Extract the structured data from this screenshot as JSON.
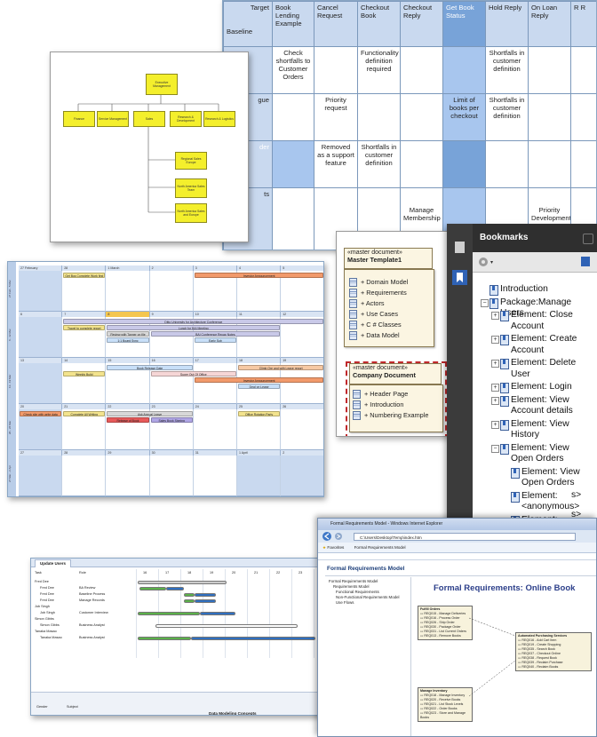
{
  "matrix": {
    "corner_top": "Target",
    "corner_bottom": "Baseline",
    "columns": [
      "Book Lending Example",
      "Cancel Request",
      "Checkout Book",
      "Checkout Reply",
      "Get Book Status",
      "Hold Reply",
      "On Loan Reply",
      "R R"
    ],
    "rows": [
      {
        "label": "",
        "cells": [
          "Check shortfalls to Customer Orders",
          "",
          "Functionality definition required",
          "",
          "",
          "Shortfalls in customer definition",
          "",
          ""
        ]
      },
      {
        "label": "gue",
        "cells": [
          "",
          "Priority request",
          "",
          "",
          "Limit of books per checkout",
          "Shortfalls in customer definition",
          "",
          ""
        ]
      },
      {
        "label": "der",
        "cells": [
          "",
          "Removed as a support feature",
          "Shortfalls in customer definition",
          "",
          "",
          "",
          "",
          ""
        ]
      },
      {
        "label": "ts",
        "cells": [
          "",
          "",
          "",
          "Manage Membership",
          "",
          "",
          "Priority Development",
          ""
        ]
      }
    ]
  },
  "org_chart": {
    "root": "Executive Management",
    "level2": [
      "Finance",
      "Service Management",
      "Sales",
      "Research & Development",
      "Research & Logistics"
    ],
    "level3": [
      "Regional Sales Europe",
      "North America Sales Team",
      "North America Sales and Europe"
    ]
  },
  "calendar": {
    "day_headers": [
      [
        "27 February",
        "28",
        "1 March",
        "2",
        "3",
        "4",
        "5"
      ],
      [
        "6",
        "7",
        "8",
        "9",
        "10",
        "11",
        "12"
      ],
      [
        "13",
        "14",
        "15",
        "16",
        "17",
        "18",
        "19"
      ],
      [
        "20",
        "21",
        "22",
        "23",
        "24",
        "25",
        "26"
      ],
      [
        "27",
        "28",
        "29",
        "30",
        "31",
        "1 April",
        "2"
      ]
    ],
    "week_labels": [
      "27 Feb - 5 Mar",
      "6 - 12 Mar",
      "13 - 19 Mar",
      "20 - 26 Mar",
      "27 Mar - 2 Apr"
    ],
    "events": [
      {
        "text": "Get Bus Complete Work first",
        "week": 0,
        "start": 1,
        "span": 1,
        "row": 0,
        "color": "#f3e38d"
      },
      {
        "text": "Investor Announcement",
        "week": 0,
        "start": 4,
        "span": 3,
        "row": 0,
        "color": "#f29a6b"
      },
      {
        "text": "Ditto University for Architecture Conference",
        "week": 1,
        "start": 1,
        "span": 6,
        "row": 0,
        "color": "#c9c9e8"
      },
      {
        "text": "Travel to complete report",
        "week": 1,
        "start": 1,
        "span": 1,
        "row": 1,
        "color": "#f3e38d"
      },
      {
        "text": "Lunch for BAI Meeting",
        "week": 1,
        "start": 2,
        "span": 4,
        "row": 1,
        "color": "#c9c9e8"
      },
      {
        "text": "Review with Tanner on file",
        "week": 1,
        "start": 2,
        "span": 1,
        "row": 2,
        "color": "#d8d8d8"
      },
      {
        "text": "BAI Conference Recap Notes",
        "week": 1,
        "start": 3,
        "span": 3,
        "row": 2,
        "color": "#c9c9e8"
      },
      {
        "text": "1:1 Board Sync",
        "week": 1,
        "start": 2,
        "span": 1,
        "row": 3,
        "color": "#c8dff8"
      },
      {
        "text": "Early Sub",
        "week": 1,
        "start": 4,
        "span": 1,
        "row": 3,
        "color": "#c8dff8"
      },
      {
        "text": "Book Release Date",
        "week": 2,
        "start": 2,
        "span": 2,
        "row": 0,
        "color": "#c8dff8"
      },
      {
        "text": "Climb Ore and with Leave report",
        "week": 2,
        "start": 5,
        "span": 2,
        "row": 0,
        "color": "#f6c9a4"
      },
      {
        "text": "Weekly Build",
        "week": 2,
        "start": 1,
        "span": 1,
        "row": 1,
        "color": "#f3e38d"
      },
      {
        "text": "Super Out Of Office",
        "week": 2,
        "start": 3,
        "span": 2,
        "row": 1,
        "color": "#f6d6d6"
      },
      {
        "text": "Investor Announcement",
        "week": 2,
        "start": 4,
        "span": 3,
        "row": 2,
        "color": "#f29a6b"
      },
      {
        "text": "Deal on Lease",
        "week": 2,
        "start": 5,
        "span": 1,
        "row": 3,
        "color": "#c8dff8"
      },
      {
        "text": "Check site with write data",
        "week": 3,
        "start": 0,
        "span": 1,
        "row": 0,
        "color": "#f29a6b"
      },
      {
        "text": "Complete All Writing",
        "week": 3,
        "start": 1,
        "span": 1,
        "row": 0,
        "color": "#f3e38d"
      },
      {
        "text": "Ask Annual Leave",
        "week": 3,
        "start": 2,
        "span": 2,
        "row": 0,
        "color": "#d8d8d8"
      },
      {
        "text": "Office Rotation Party",
        "week": 3,
        "start": 5,
        "span": 1,
        "row": 0,
        "color": "#f3e38d"
      },
      {
        "text": "Release of Book",
        "week": 3,
        "start": 2,
        "span": 1,
        "row": 1,
        "color": "#e85a5a"
      },
      {
        "text": "Sales Book Signing",
        "week": 3,
        "start": 3,
        "span": 1,
        "row": 1,
        "color": "#b0a6e6"
      }
    ]
  },
  "master_docs": {
    "doc1": {
      "stereotype": "«master document»",
      "name": "Master Template1",
      "items": [
        "+ Domain Model",
        "+ Requirements",
        "+ Actors",
        "+ Use Cases",
        "+ C # Classes",
        "+ Data Model"
      ]
    },
    "doc2": {
      "stereotype": "«master document»",
      "name": "Company Document",
      "items": [
        "+ Header Page",
        "+ Introduction",
        "+ Numbering Example"
      ]
    }
  },
  "bookmarks": {
    "title": "Bookmarks",
    "nodes": [
      {
        "label": "Introduction",
        "level": 0,
        "pm": ""
      },
      {
        "label": "Package:Manage Users",
        "level": 0,
        "pm": "−"
      },
      {
        "label": "Element: Close Account",
        "level": 1,
        "pm": "+"
      },
      {
        "label": "Element: Create Account",
        "level": 1,
        "pm": "+"
      },
      {
        "label": "Element: Delete User",
        "level": 1,
        "pm": "+"
      },
      {
        "label": "Element: Login",
        "level": 1,
        "pm": "+"
      },
      {
        "label": "Element: View Account details",
        "level": 1,
        "pm": "+"
      },
      {
        "label": "Element: View History",
        "level": 1,
        "pm": "+"
      },
      {
        "label": "Element: View Open Orders",
        "level": 1,
        "pm": "−"
      },
      {
        "label": "Element: View Open Orders",
        "level": 2,
        "pm": ""
      },
      {
        "label": "Element: <anonymous>",
        "level": 2,
        "pm": ""
      },
      {
        "label": "Element:",
        "level": 2,
        "pm": ""
      }
    ],
    "overflow_fragments": [
      "s>",
      "s>",
      "s>"
    ]
  },
  "gantt": {
    "tab": "Update Users",
    "col_task": "Task",
    "col_role": "Role",
    "dates": [
      "16",
      "17",
      "18",
      "19",
      "20",
      "21",
      "22",
      "23"
    ],
    "rows": [
      {
        "task": "Fred Dee",
        "role": ""
      },
      {
        "task": "Fred Dee",
        "role": "BA Review"
      },
      {
        "task": "Fred Dee",
        "role": "Baseline Process"
      },
      {
        "task": "Fred Dee",
        "role": "Manage Records"
      },
      {
        "task": "Job Singh",
        "role": ""
      },
      {
        "task": "Job Singh",
        "role": "Customer Interview"
      },
      {
        "task": "Simon Gibbs",
        "role": ""
      },
      {
        "task": "Simon Gibbs",
        "role": "Business Analyst"
      },
      {
        "task": "Tanaka Masao",
        "role": ""
      },
      {
        "task": "Tanaka Masao",
        "role": "Business Analyst"
      }
    ],
    "footer_label": "Gender",
    "footer_subject": "Subject",
    "footer_note": "Data Modeling Concepts"
  },
  "browser": {
    "window_title": "Formal Requirements Model - Windows Internet Explorer",
    "address": "C:\\Users\\Desktop\\Temp\\index.htm",
    "favorites": "Favorites",
    "fav_tab": "Formal Requirements Model",
    "page_title": "Formal Requirements Model",
    "heading": "Formal Requirements: Online Book",
    "tree": [
      "Formal Requirements Model",
      "Requirements Model",
      "Functional Requirements",
      "Non-Functional Requirements Model",
      "Use Flows"
    ],
    "pkg1": {
      "name": "Fulfill Orders",
      "items": [
        "REQ015 - Manage Deliveries",
        "REQ016 - Process Order",
        "REQ026 - Ship Order",
        "REQ030 - Package Order",
        "REQ031 - List Current Orders",
        "REQ013 - Remove Books"
      ]
    },
    "pkg2": {
      "name": "Automated Purchasing Services",
      "items": [
        "REQ016 - Add Cart Item",
        "REQ019 - Create Shopping",
        "REQ035 - Search Book",
        "REQ037 - Checkout Online",
        "REQ038 - Request Book",
        "REQ039 - Reclaim Purchase",
        "REQ040 - Reclaim Books"
      ]
    },
    "pkg3": {
      "name": "Manage Inventory",
      "items": [
        "REQ018 - Manage Inventory",
        "REQ020 - Receive Books",
        "REQ021 - List Stock Levels",
        "REQ022 - Order Books",
        "REQ023 - Store and Manage Books"
      ]
    }
  },
  "colors": {
    "matrix_header": "#c9d9ef",
    "matrix_highlight": "#78a3d8",
    "org_box": "#f4ef2c",
    "bookmarks_dark": "#2f2f2f",
    "ie_heading": "#2c3f8a"
  }
}
